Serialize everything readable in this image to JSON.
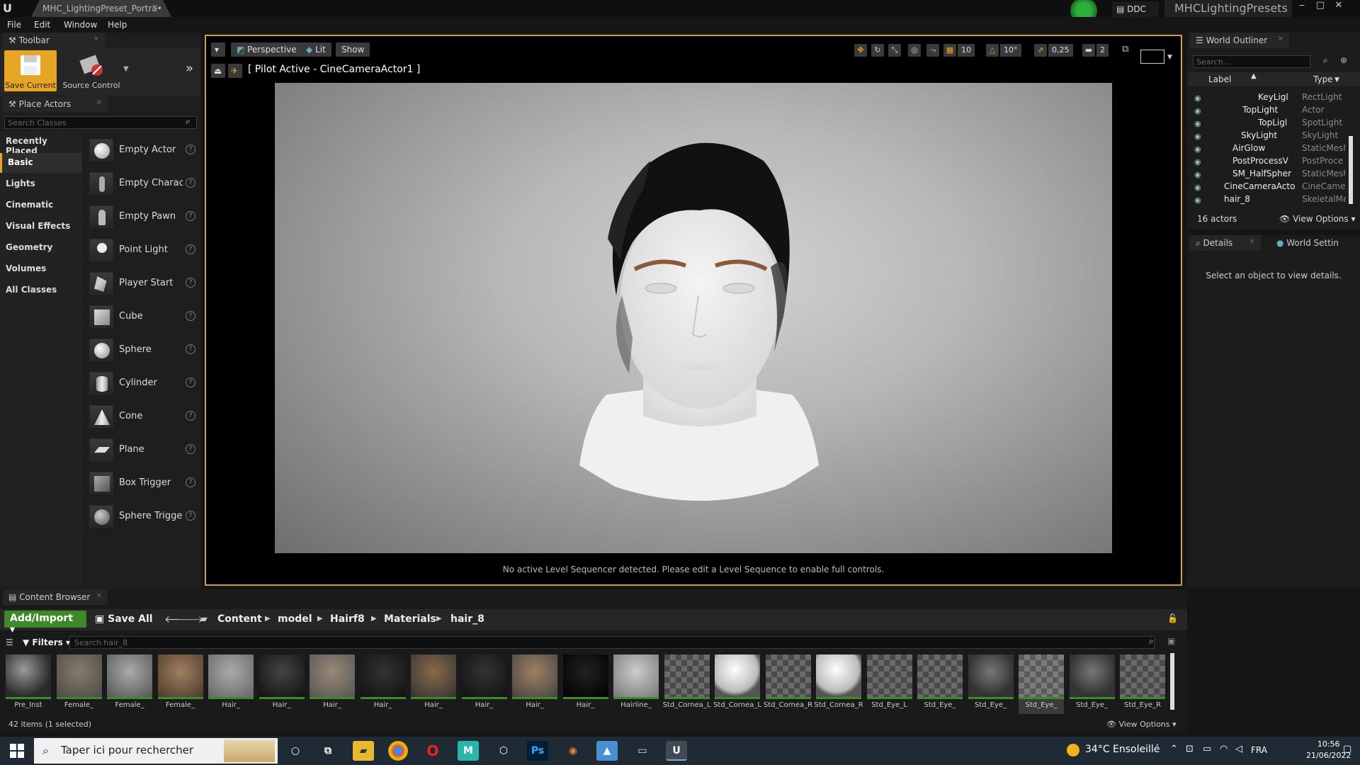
{
  "titlebar": {
    "document_tab": "MHC_LightingPreset_Portra•",
    "ddc": "DDC",
    "project": "MHCLightingPresets",
    "minimize": "‒",
    "maximize": "□",
    "close": "✕"
  },
  "menu": [
    "File",
    "Edit",
    "Window",
    "Help"
  ],
  "toolbar": {
    "tab_label": "Toolbar",
    "save_current": "Save Current",
    "source_control": "Source Control"
  },
  "place_actors": {
    "tab_label": "Place Actors",
    "search_placeholder": "Search Classes",
    "categories": [
      "Recently Placed",
      "Basic",
      "Lights",
      "Cinematic",
      "Visual Effects",
      "Geometry",
      "Volumes",
      "All Classes"
    ],
    "selected_category": "Basic",
    "actors": [
      "Empty Actor",
      "Empty Charact",
      "Empty Pawn",
      "Point Light",
      "Player Start",
      "Cube",
      "Sphere",
      "Cylinder",
      "Cone",
      "Plane",
      "Box Trigger",
      "Sphere Trigger"
    ]
  },
  "viewport": {
    "perspective": "Perspective",
    "lit": "Lit",
    "show": "Show",
    "pilot_text": "[ Pilot Active - CineCameraActor1 ]",
    "grid_snap": "10",
    "rotation_snap": "10°",
    "scale_snap": "0,25",
    "camera_speed": "2",
    "sequencer_message": "No active Level Sequencer detected. Please edit a Level Sequence to enable full controls."
  },
  "outliner": {
    "tab_label": "World Outliner",
    "search_placeholder": "Search...",
    "col_label": "Label",
    "col_type": "Type",
    "rows": [
      {
        "label": "KeyLigl",
        "type": "RectLight"
      },
      {
        "label": "TopLight",
        "type": "Actor"
      },
      {
        "label": "TopLigl",
        "type": "SpotLight"
      },
      {
        "label": "SkyLight",
        "type": "SkyLight"
      },
      {
        "label": "AirGlow",
        "type": "StaticMesh"
      },
      {
        "label": "PostProcessV",
        "type": "PostProce"
      },
      {
        "label": "SM_HalfSpher",
        "type": "StaticMesh"
      },
      {
        "label": "CineCameraActo",
        "type": "CineCame"
      },
      {
        "label": "hair_8",
        "type": "SkeletalMe"
      }
    ],
    "actor_count": "16 actors",
    "view_options": "View Options"
  },
  "details": {
    "tab_label": "Details",
    "world_settings_tab": "World Settin",
    "empty_message": "Select an object to view details."
  },
  "content_browser": {
    "tab_label": "Content Browser",
    "add_import": "Add/Import",
    "save_all": "Save All",
    "breadcrumbs": [
      "Content",
      "model",
      "Hairf8",
      "Materials",
      "hair_8"
    ],
    "filters": "Filters",
    "search_placeholder": "Search hair_8",
    "assets": [
      "Pre_Inst",
      "Female_",
      "Female_",
      "Female_",
      "Hair_",
      "Hair_",
      "Hair_",
      "Hair_",
      "Hair_",
      "Hair_",
      "Hair_",
      "Hair_",
      "Hairline_",
      "Std_Cornea_L",
      "Std_Cornea_L",
      "Std_Cornea_R",
      "Std_Cornea_R",
      "Std_Eye_L",
      "Std_Eye_",
      "Std_Eye_",
      "Std_Eye_",
      "Std_Eye_",
      "Std_Eye_R"
    ],
    "items_count": "42 items (1 selected)",
    "view_options": "View Options"
  },
  "taskbar": {
    "search_placeholder": "Taper ici pour rechercher",
    "weather": "34°C  Ensoleillé",
    "language": "FRA",
    "time": "10:56",
    "date": "21/06/2022"
  }
}
